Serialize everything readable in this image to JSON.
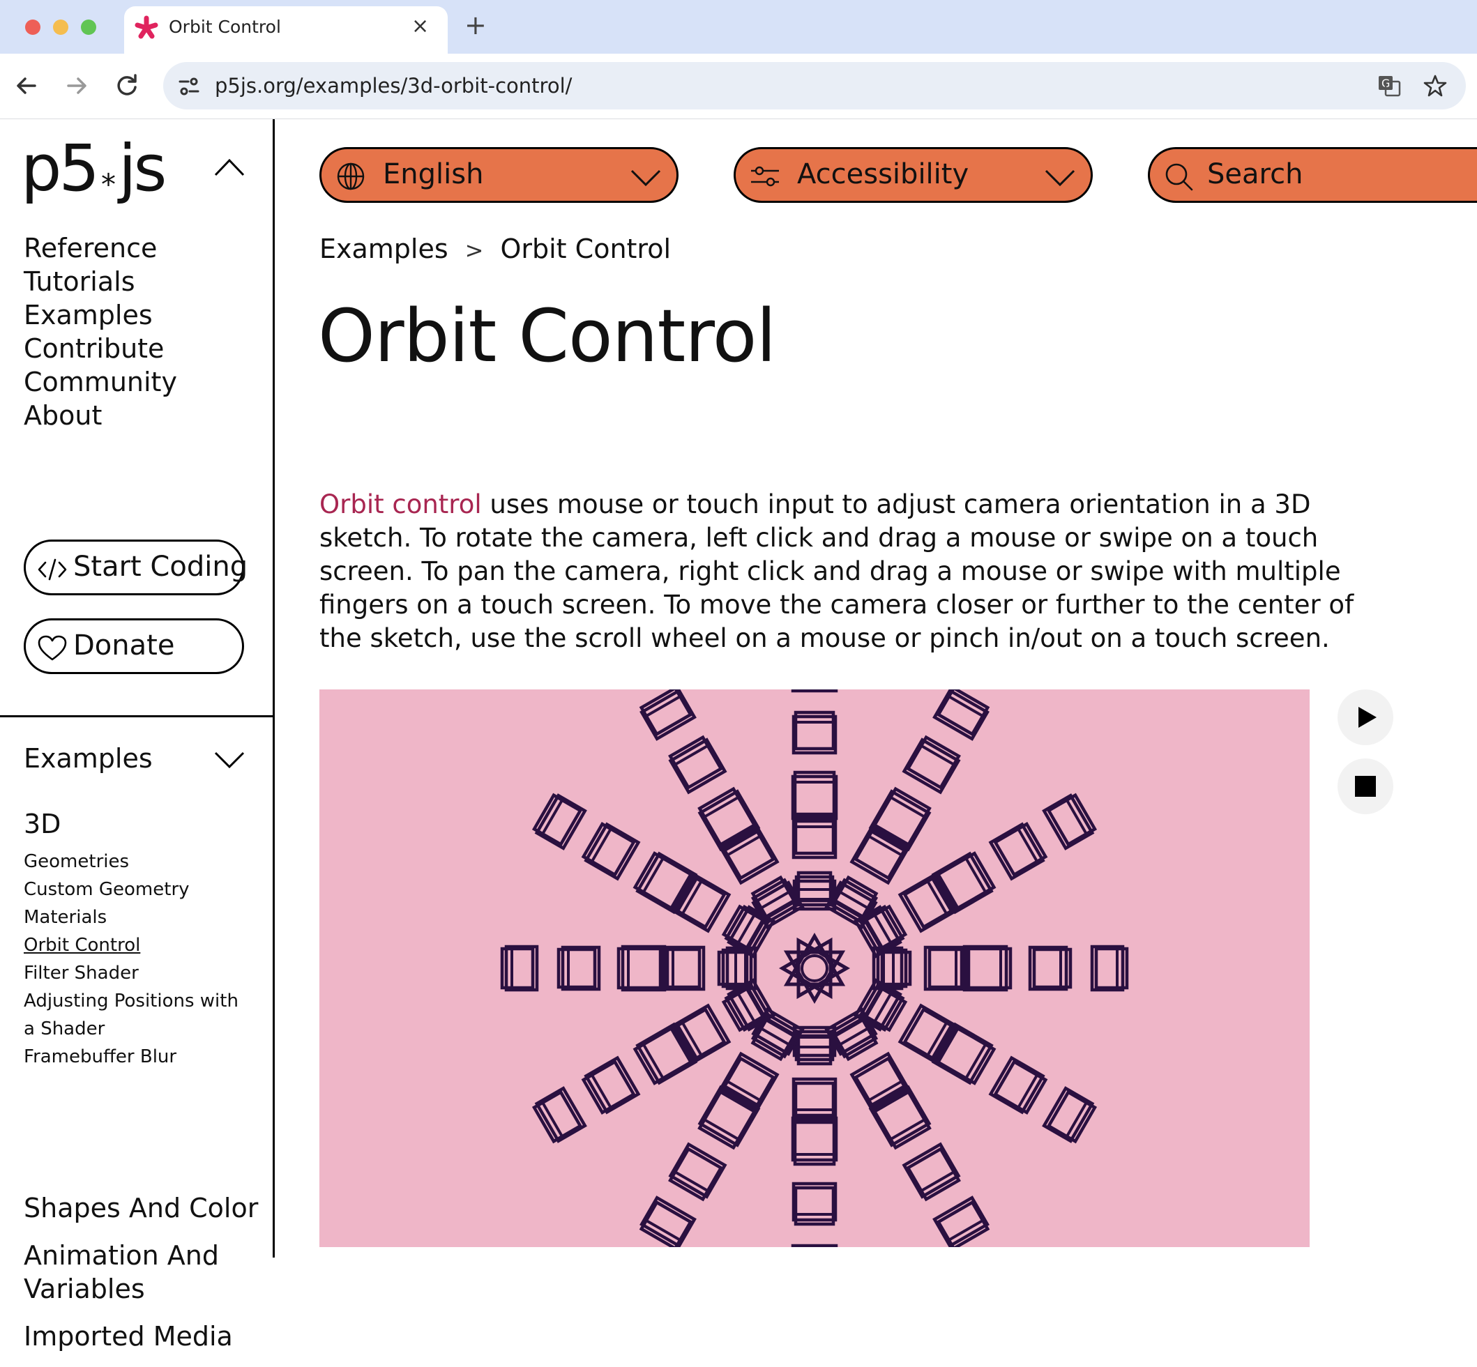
{
  "browser": {
    "tab_title": "Orbit Control",
    "tab_close_glyph": "×",
    "new_tab_glyph": "+",
    "url": "p5js.org/examples/3d-orbit-control/",
    "favicon": "asterisk-icon",
    "favicon_color": "#e0245e"
  },
  "sidebar": {
    "logo_left": "p5",
    "logo_mid": "*",
    "logo_right": "js",
    "nav": [
      "Reference",
      "Tutorials",
      "Examples",
      "Contribute",
      "Community",
      "About"
    ],
    "start_coding_label": "Start Coding",
    "donate_label": "Donate",
    "examples_heading": "Examples",
    "current_category": "3D",
    "sub_items": [
      "Geometries",
      "Custom Geometry",
      "Materials",
      "Orbit Control",
      "Filter Shader",
      "Adjusting Positions with a Shader",
      "Framebuffer Blur"
    ],
    "current_sub_item": "Orbit Control",
    "categories": [
      "Shapes And Color",
      "Animation And Variables",
      "Imported Media"
    ]
  },
  "topbar": {
    "language_label": "English",
    "accessibility_label": "Accessibility",
    "search_label": "Search",
    "accent_color": "#e6744a"
  },
  "breadcrumb": {
    "parent": "Examples",
    "separator": ">",
    "current": "Orbit Control"
  },
  "main": {
    "title": "Orbit Control",
    "description_link": "Orbit control",
    "description_rest": " uses mouse or touch input to adjust camera orientation in a 3D sketch. To rotate the camera, left click and drag a mouse or swipe on a touch screen. To pan the camera, right click and drag a mouse or swipe with multiple fingers on a touch screen. To move the camera closer or further to the center of the sketch, use the scroll wheel on a mouse or pinch in/out on a touch screen.",
    "link_color": "#a82651"
  },
  "sketch": {
    "background_color": "#efb6c8",
    "stroke_color": "#2a1040",
    "play_icon": "play-icon",
    "stop_icon": "stop-icon"
  }
}
